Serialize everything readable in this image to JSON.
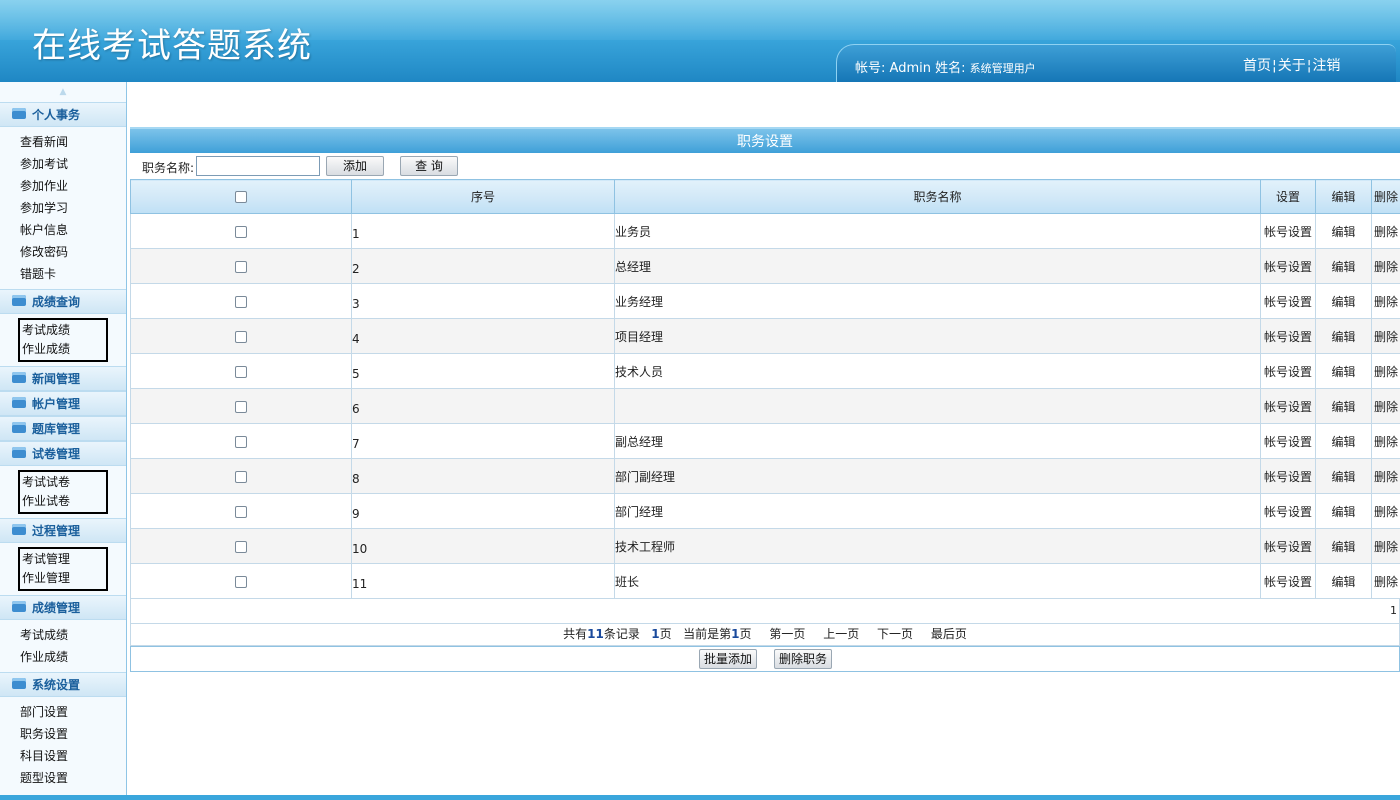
{
  "header": {
    "app_title": "在线考试答题系统",
    "account_label": "帐号:",
    "account_value": "Admin",
    "name_label": "姓名:",
    "name_value": "系统管理用户",
    "links": [
      "首页",
      "关于",
      "注销"
    ]
  },
  "sidebar": {
    "groups": [
      {
        "title": "个人事务",
        "items": [
          "查看新闻",
          "参加考试",
          "参加作业",
          "参加学习",
          "帐户信息",
          "修改密码",
          "错题卡"
        ]
      },
      {
        "title": "成绩查询",
        "items": [
          "考试成绩",
          "作业成绩"
        ]
      },
      {
        "title": "新闻管理",
        "items": []
      },
      {
        "title": "帐户管理",
        "items": []
      },
      {
        "title": "题库管理",
        "items": []
      },
      {
        "title": "试卷管理",
        "items": [
          "考试试卷",
          "作业试卷"
        ]
      },
      {
        "title": "过程管理",
        "items": [
          "考试管理",
          "作业管理"
        ]
      },
      {
        "title": "成绩管理",
        "items": [
          "考试成绩",
          "作业成绩"
        ]
      },
      {
        "title": "系统设置",
        "items": [
          "部门设置",
          "职务设置",
          "科目设置",
          "题型设置"
        ]
      }
    ]
  },
  "main": {
    "panel_title": "职务设置",
    "search_label": "职务名称:",
    "search_value": "",
    "add_button": "添加",
    "query_button": "查 询",
    "columns": {
      "seq": "序号",
      "name": "职务名称",
      "settings": "设置",
      "edit": "编辑",
      "delete": "删除"
    },
    "row_action_settings": "帐号设置",
    "row_action_edit": "编辑",
    "row_action_delete": "删除",
    "rows": [
      {
        "seq": "1",
        "name": "业务员"
      },
      {
        "seq": "2",
        "name": "总经理"
      },
      {
        "seq": "3",
        "name": "业务经理"
      },
      {
        "seq": "4",
        "name": "项目经理"
      },
      {
        "seq": "5",
        "name": "技术人员"
      },
      {
        "seq": "6",
        "name": ""
      },
      {
        "seq": "7",
        "name": "副总经理"
      },
      {
        "seq": "8",
        "name": "部门副经理"
      },
      {
        "seq": "9",
        "name": "部门经理"
      },
      {
        "seq": "10",
        "name": "技术工程师"
      },
      {
        "seq": "11",
        "name": "班长"
      }
    ],
    "page_corner": "1",
    "pager": {
      "total_prefix": "共有",
      "total_count": "11",
      "total_suffix": "条记录",
      "pages_count": "1",
      "pages_suffix": "页",
      "current_prefix": "当前是第",
      "current_page": "1",
      "current_suffix": "页",
      "first": "第一页",
      "prev": "上一页",
      "next": "下一页",
      "last": "最后页"
    },
    "batch_add_button": "批量添加",
    "delete_button": "删除职务"
  }
}
